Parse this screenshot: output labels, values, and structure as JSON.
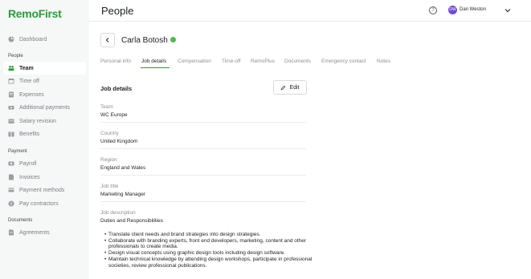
{
  "app": {
    "logo": "RemoFirst"
  },
  "sidebar": {
    "items_top": [
      {
        "label": "Dashboard",
        "icon": "dashboard-icon"
      }
    ],
    "sections": [
      {
        "title": "People",
        "items": [
          {
            "label": "Team",
            "icon": "team-icon",
            "active": true
          },
          {
            "label": "Time off",
            "icon": "calendar-icon"
          },
          {
            "label": "Expenses",
            "icon": "receipt-icon"
          },
          {
            "label": "Additional payments",
            "icon": "payment-icon"
          },
          {
            "label": "Salary revision",
            "icon": "salary-icon"
          },
          {
            "label": "Benefits",
            "icon": "benefits-icon"
          }
        ]
      },
      {
        "title": "Payment",
        "items": [
          {
            "label": "Payroll",
            "icon": "payroll-icon"
          },
          {
            "label": "Invoices",
            "icon": "invoice-icon"
          },
          {
            "label": "Payment methods",
            "icon": "card-icon"
          },
          {
            "label": "Pay contractors",
            "icon": "contractor-icon"
          }
        ]
      },
      {
        "title": "Documents",
        "items": [
          {
            "label": "Agreements",
            "icon": "document-icon"
          }
        ]
      }
    ]
  },
  "header": {
    "title": "People",
    "user_name": "Dan Weston",
    "user_initials": "DW",
    "help_glyph": "?"
  },
  "profile": {
    "name": "Carla Botosh"
  },
  "tabs": [
    {
      "label": "Personal info"
    },
    {
      "label": "Job details",
      "active": true
    },
    {
      "label": "Compensation"
    },
    {
      "label": "Time-off"
    },
    {
      "label": "RemoPlus"
    },
    {
      "label": "Documents"
    },
    {
      "label": "Emergency contact"
    },
    {
      "label": "Notes"
    }
  ],
  "job_details": {
    "title": "Job details",
    "edit_label": "Edit",
    "fields": [
      {
        "label": "Team",
        "value": "WC Europe"
      },
      {
        "label": "Country",
        "value": "United Kingdom"
      },
      {
        "label": "Region",
        "value": "England and Wales"
      },
      {
        "label": "Job title",
        "value": "Marketing Manager"
      }
    ],
    "description_label": "Job description",
    "description_heading": "Duties and Responsibilities",
    "bullets": [
      "Translate client needs and brand strategies into design strategies.",
      "Collaborate with branding experts, front end developers, marketing, content and other professionals to create media.",
      "Design visual concepts using graphic design tools including design software.",
      "Maintain technical knowledge by attending design workshops, participate in professional societies, review professional publications."
    ]
  },
  "colors": {
    "brand": "#2a9d3c",
    "avatar": "#6f4bd8",
    "status": "#50b848"
  }
}
